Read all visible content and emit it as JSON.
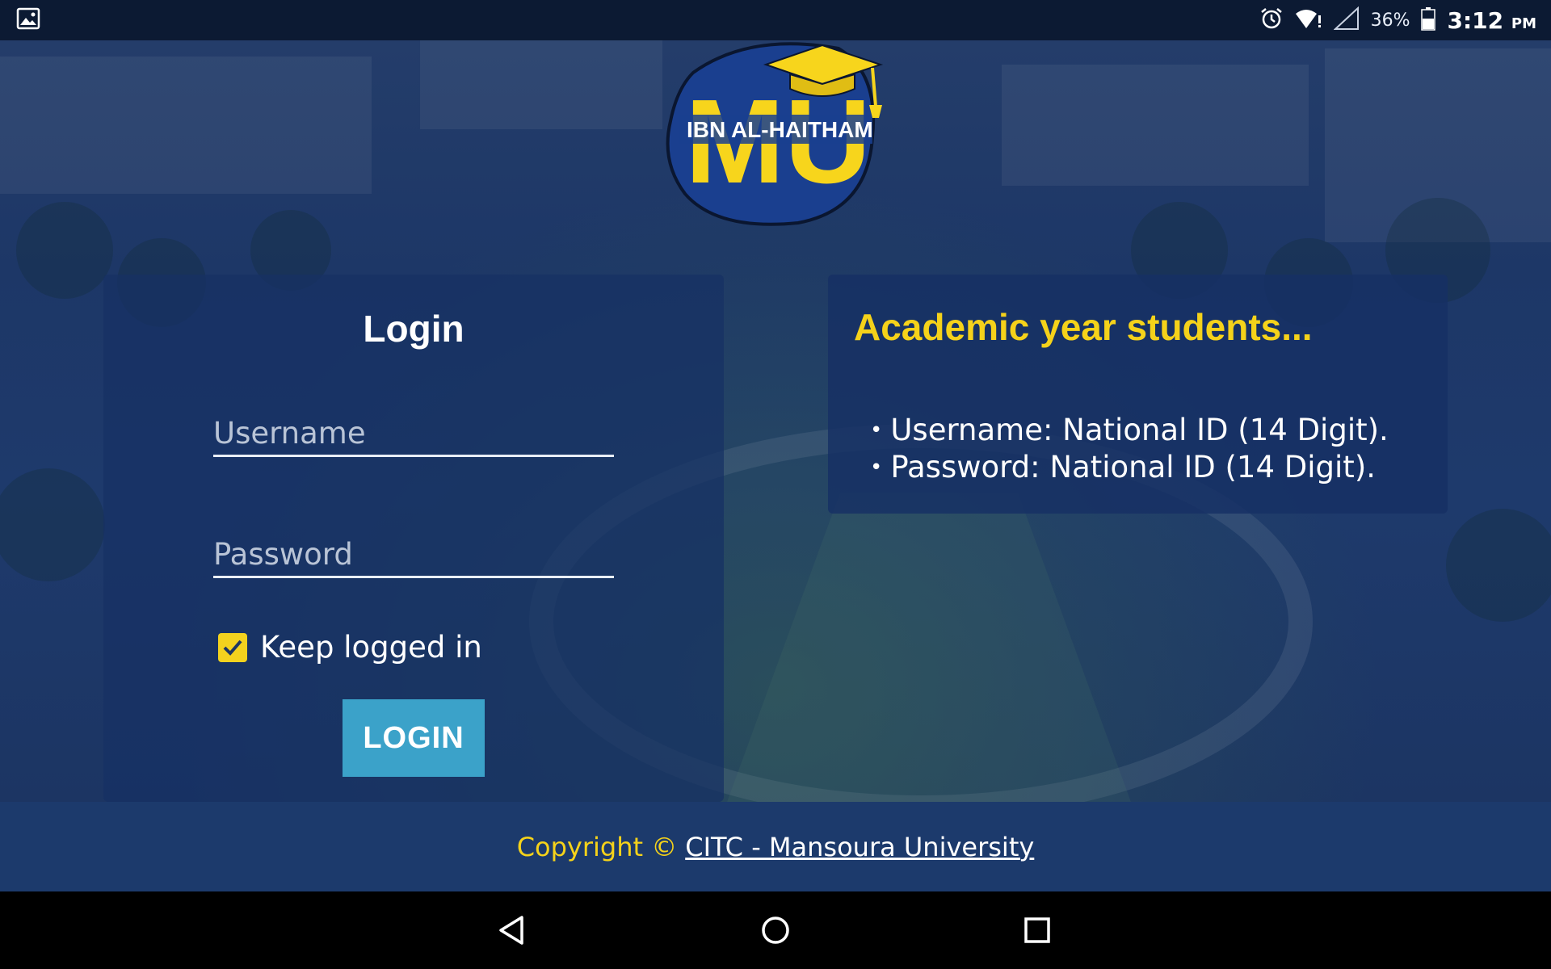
{
  "status_bar": {
    "battery_percent": "36%",
    "time": "3:12",
    "ampm": "PM",
    "icons": [
      "image-icon",
      "alarm-icon",
      "wifi-icon",
      "signal-icon",
      "battery-icon"
    ]
  },
  "logo": {
    "letters": "MU",
    "subtitle": "IBN AL-HAITHAM"
  },
  "login": {
    "title": "Login",
    "username_placeholder": "Username",
    "username_value": "",
    "password_placeholder": "Password",
    "password_value": "",
    "keep_logged_in_label": "Keep logged in",
    "keep_logged_in_checked": true,
    "button_label": "LOGIN"
  },
  "info": {
    "title": "Academic year students...",
    "items": [
      "Username: National ID (14 Digit).",
      "Password: National ID (14 Digit)."
    ]
  },
  "footer": {
    "copyright": "Copyright ©",
    "link_text": "CITC - Mansoura University"
  },
  "nav_bar": {
    "icons": [
      "back-icon",
      "home-icon",
      "recent-apps-icon"
    ]
  },
  "colors": {
    "accent_yellow": "#f5d21a",
    "button_blue": "#3ba2c9",
    "card_bg": "#16306a",
    "footer_bg": "#1c3a6c"
  }
}
